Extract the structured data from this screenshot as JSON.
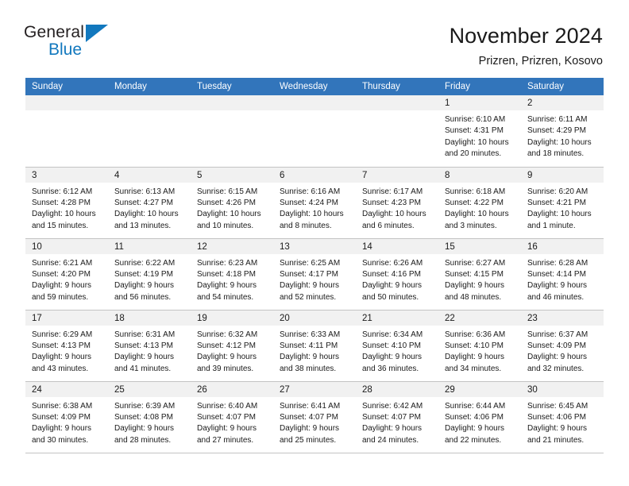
{
  "logo": {
    "word_one": "General",
    "word_two": "Blue",
    "triangle_color": "#1278be"
  },
  "header": {
    "title": "November 2024",
    "subtitle": "Prizren, Prizren, Kosovo"
  },
  "theme": {
    "header_blue": "#3275bb",
    "daynum_band": "#f1f1f1",
    "grid_line": "#c3c3c3",
    "text": "#1a1a1a"
  },
  "weekday_headers": [
    "Sunday",
    "Monday",
    "Tuesday",
    "Wednesday",
    "Thursday",
    "Friday",
    "Saturday"
  ],
  "labels": {
    "sunrise_prefix": "Sunrise:",
    "sunset_prefix": "Sunset:",
    "daylight_prefix": "Daylight:"
  },
  "weeks": [
    [
      {
        "day": "",
        "empty": true
      },
      {
        "day": "",
        "empty": true
      },
      {
        "day": "",
        "empty": true
      },
      {
        "day": "",
        "empty": true
      },
      {
        "day": "",
        "empty": true
      },
      {
        "day": "1",
        "sunrise": "Sunrise: 6:10 AM",
        "sunset": "Sunset: 4:31 PM",
        "daylight": "Daylight: 10 hours and 20 minutes."
      },
      {
        "day": "2",
        "sunrise": "Sunrise: 6:11 AM",
        "sunset": "Sunset: 4:29 PM",
        "daylight": "Daylight: 10 hours and 18 minutes."
      }
    ],
    [
      {
        "day": "3",
        "sunrise": "Sunrise: 6:12 AM",
        "sunset": "Sunset: 4:28 PM",
        "daylight": "Daylight: 10 hours and 15 minutes."
      },
      {
        "day": "4",
        "sunrise": "Sunrise: 6:13 AM",
        "sunset": "Sunset: 4:27 PM",
        "daylight": "Daylight: 10 hours and 13 minutes."
      },
      {
        "day": "5",
        "sunrise": "Sunrise: 6:15 AM",
        "sunset": "Sunset: 4:26 PM",
        "daylight": "Daylight: 10 hours and 10 minutes."
      },
      {
        "day": "6",
        "sunrise": "Sunrise: 6:16 AM",
        "sunset": "Sunset: 4:24 PM",
        "daylight": "Daylight: 10 hours and 8 minutes."
      },
      {
        "day": "7",
        "sunrise": "Sunrise: 6:17 AM",
        "sunset": "Sunset: 4:23 PM",
        "daylight": "Daylight: 10 hours and 6 minutes."
      },
      {
        "day": "8",
        "sunrise": "Sunrise: 6:18 AM",
        "sunset": "Sunset: 4:22 PM",
        "daylight": "Daylight: 10 hours and 3 minutes."
      },
      {
        "day": "9",
        "sunrise": "Sunrise: 6:20 AM",
        "sunset": "Sunset: 4:21 PM",
        "daylight": "Daylight: 10 hours and 1 minute."
      }
    ],
    [
      {
        "day": "10",
        "sunrise": "Sunrise: 6:21 AM",
        "sunset": "Sunset: 4:20 PM",
        "daylight": "Daylight: 9 hours and 59 minutes."
      },
      {
        "day": "11",
        "sunrise": "Sunrise: 6:22 AM",
        "sunset": "Sunset: 4:19 PM",
        "daylight": "Daylight: 9 hours and 56 minutes."
      },
      {
        "day": "12",
        "sunrise": "Sunrise: 6:23 AM",
        "sunset": "Sunset: 4:18 PM",
        "daylight": "Daylight: 9 hours and 54 minutes."
      },
      {
        "day": "13",
        "sunrise": "Sunrise: 6:25 AM",
        "sunset": "Sunset: 4:17 PM",
        "daylight": "Daylight: 9 hours and 52 minutes."
      },
      {
        "day": "14",
        "sunrise": "Sunrise: 6:26 AM",
        "sunset": "Sunset: 4:16 PM",
        "daylight": "Daylight: 9 hours and 50 minutes."
      },
      {
        "day": "15",
        "sunrise": "Sunrise: 6:27 AM",
        "sunset": "Sunset: 4:15 PM",
        "daylight": "Daylight: 9 hours and 48 minutes."
      },
      {
        "day": "16",
        "sunrise": "Sunrise: 6:28 AM",
        "sunset": "Sunset: 4:14 PM",
        "daylight": "Daylight: 9 hours and 46 minutes."
      }
    ],
    [
      {
        "day": "17",
        "sunrise": "Sunrise: 6:29 AM",
        "sunset": "Sunset: 4:13 PM",
        "daylight": "Daylight: 9 hours and 43 minutes."
      },
      {
        "day": "18",
        "sunrise": "Sunrise: 6:31 AM",
        "sunset": "Sunset: 4:13 PM",
        "daylight": "Daylight: 9 hours and 41 minutes."
      },
      {
        "day": "19",
        "sunrise": "Sunrise: 6:32 AM",
        "sunset": "Sunset: 4:12 PM",
        "daylight": "Daylight: 9 hours and 39 minutes."
      },
      {
        "day": "20",
        "sunrise": "Sunrise: 6:33 AM",
        "sunset": "Sunset: 4:11 PM",
        "daylight": "Daylight: 9 hours and 38 minutes."
      },
      {
        "day": "21",
        "sunrise": "Sunrise: 6:34 AM",
        "sunset": "Sunset: 4:10 PM",
        "daylight": "Daylight: 9 hours and 36 minutes."
      },
      {
        "day": "22",
        "sunrise": "Sunrise: 6:36 AM",
        "sunset": "Sunset: 4:10 PM",
        "daylight": "Daylight: 9 hours and 34 minutes."
      },
      {
        "day": "23",
        "sunrise": "Sunrise: 6:37 AM",
        "sunset": "Sunset: 4:09 PM",
        "daylight": "Daylight: 9 hours and 32 minutes."
      }
    ],
    [
      {
        "day": "24",
        "sunrise": "Sunrise: 6:38 AM",
        "sunset": "Sunset: 4:09 PM",
        "daylight": "Daylight: 9 hours and 30 minutes."
      },
      {
        "day": "25",
        "sunrise": "Sunrise: 6:39 AM",
        "sunset": "Sunset: 4:08 PM",
        "daylight": "Daylight: 9 hours and 28 minutes."
      },
      {
        "day": "26",
        "sunrise": "Sunrise: 6:40 AM",
        "sunset": "Sunset: 4:07 PM",
        "daylight": "Daylight: 9 hours and 27 minutes."
      },
      {
        "day": "27",
        "sunrise": "Sunrise: 6:41 AM",
        "sunset": "Sunset: 4:07 PM",
        "daylight": "Daylight: 9 hours and 25 minutes."
      },
      {
        "day": "28",
        "sunrise": "Sunrise: 6:42 AM",
        "sunset": "Sunset: 4:07 PM",
        "daylight": "Daylight: 9 hours and 24 minutes."
      },
      {
        "day": "29",
        "sunrise": "Sunrise: 6:44 AM",
        "sunset": "Sunset: 4:06 PM",
        "daylight": "Daylight: 9 hours and 22 minutes."
      },
      {
        "day": "30",
        "sunrise": "Sunrise: 6:45 AM",
        "sunset": "Sunset: 4:06 PM",
        "daylight": "Daylight: 9 hours and 21 minutes."
      }
    ]
  ]
}
